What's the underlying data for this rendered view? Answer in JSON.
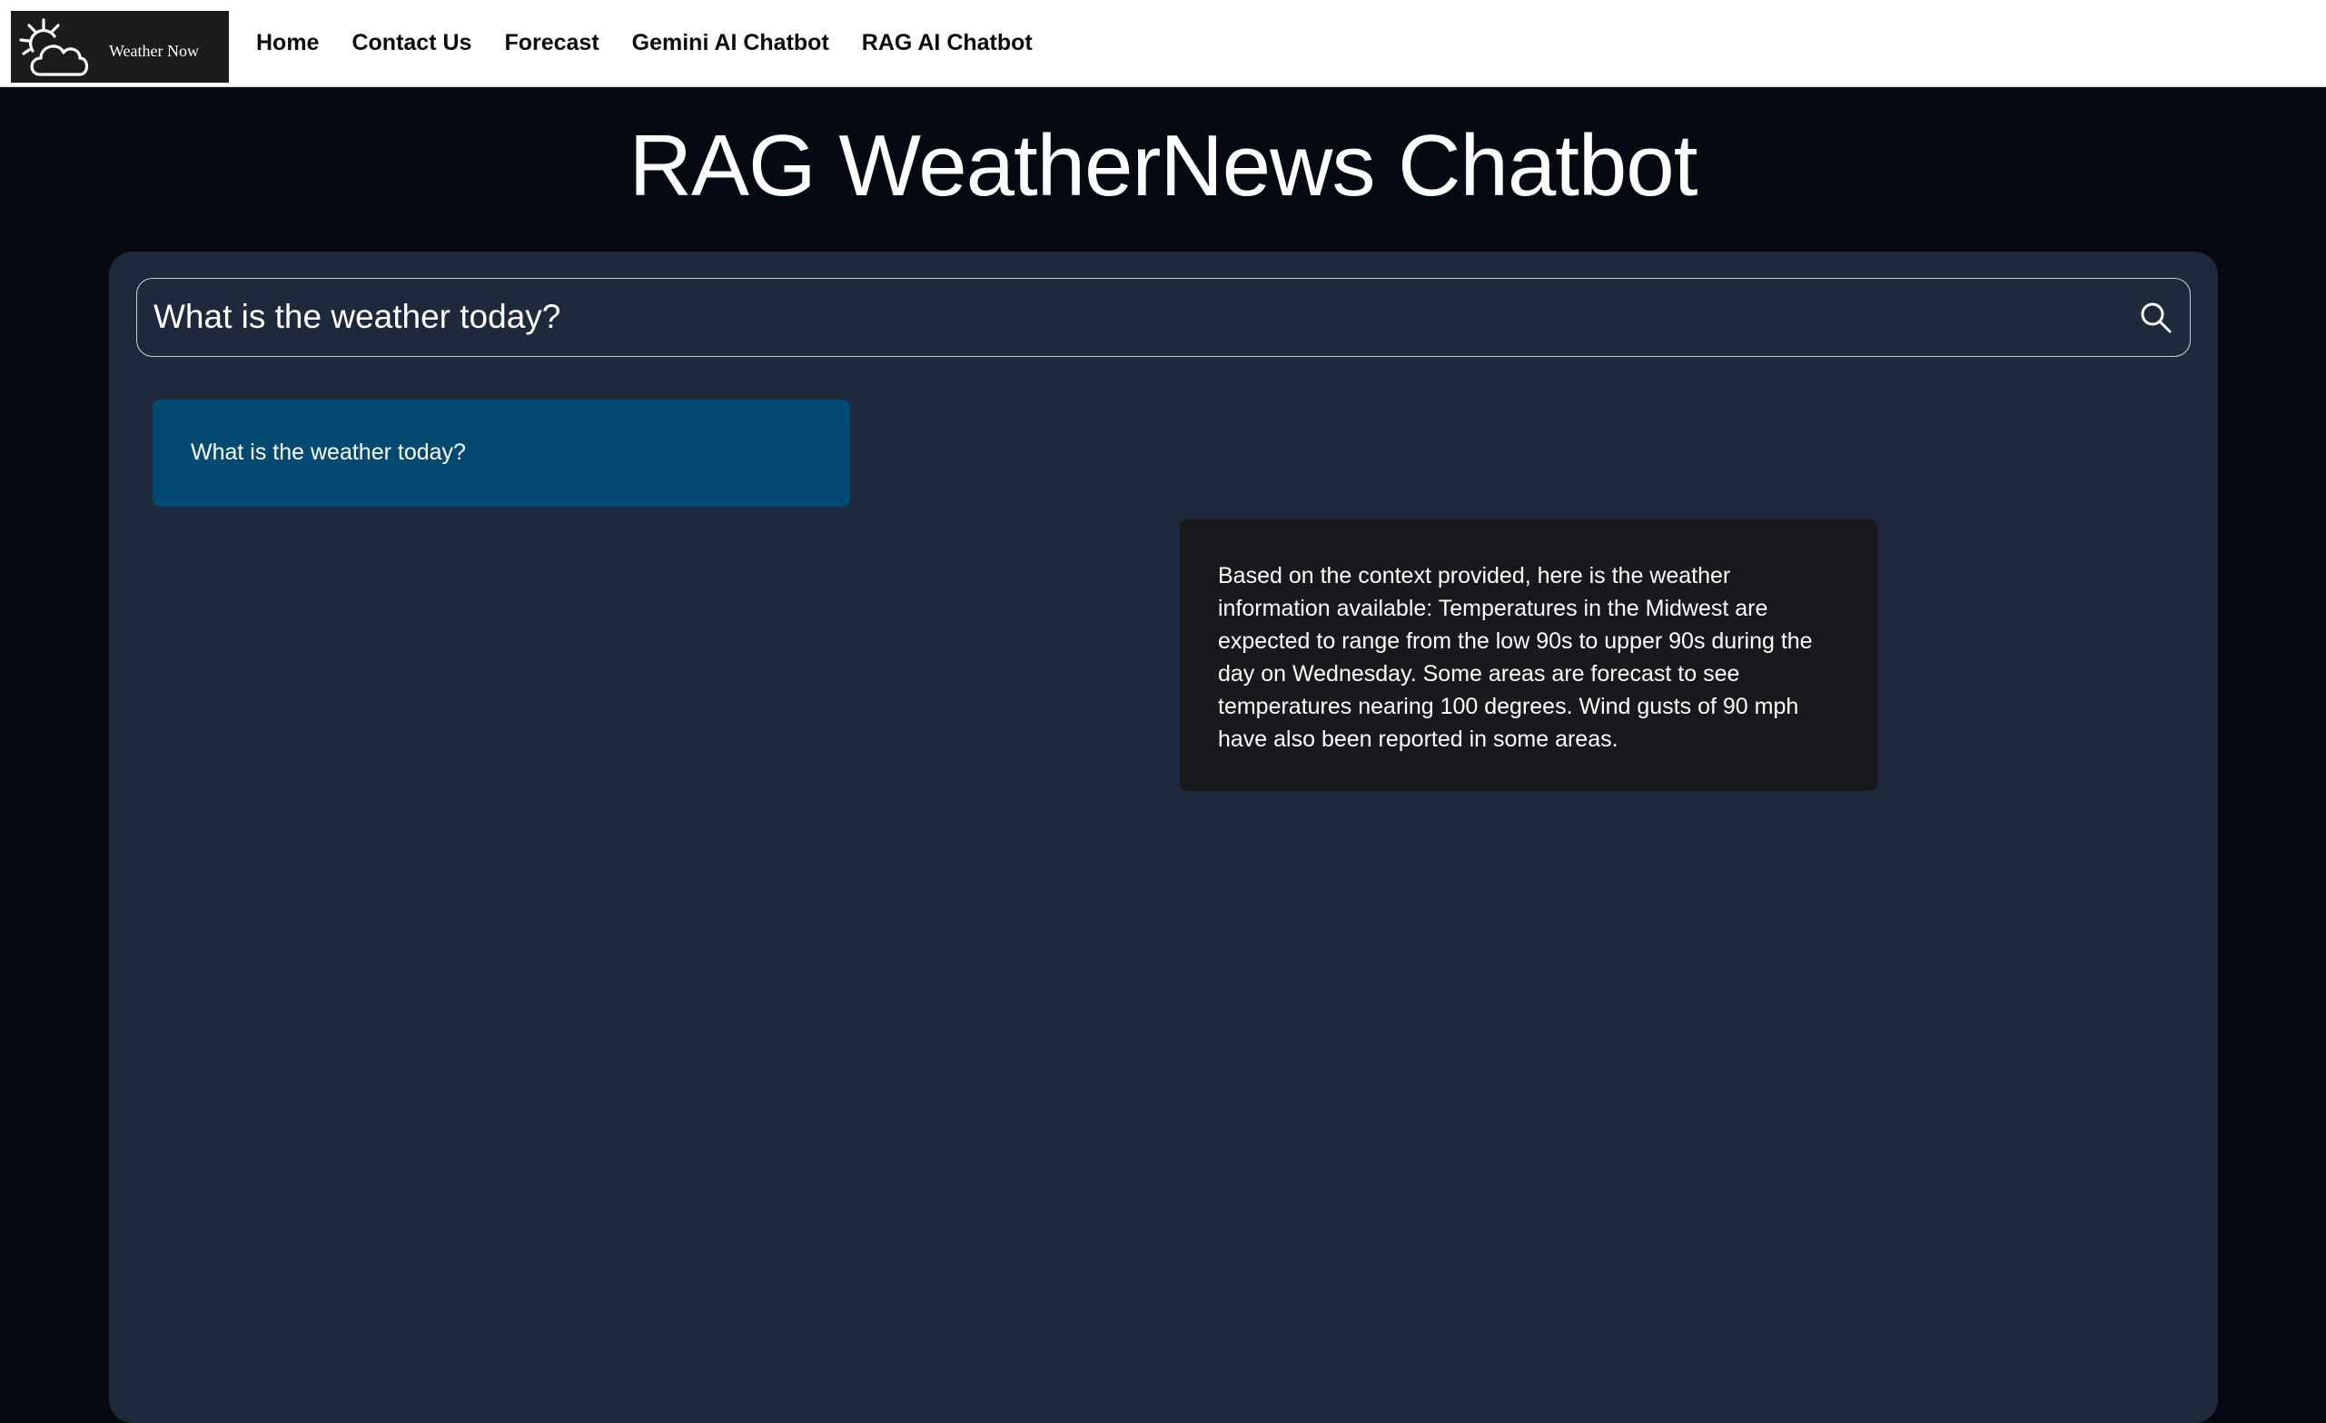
{
  "navbar": {
    "logo": {
      "icon": "sun-cloud-icon",
      "text": "Weather Now"
    },
    "links": [
      {
        "label": "Home"
      },
      {
        "label": "Contact Us"
      },
      {
        "label": "Forecast"
      },
      {
        "label": "Gemini AI Chatbot"
      },
      {
        "label": "RAG AI Chatbot"
      }
    ]
  },
  "page": {
    "title": "RAG WeatherNews Chatbot"
  },
  "search": {
    "value": "What is the weather today?",
    "icon": "search-icon"
  },
  "messages": {
    "user": {
      "text": "What is the weather today?"
    },
    "bot": {
      "text": "Based on the context provided, here is the weather information available: Temperatures in the Midwest are expected to range from the low 90s to upper 90s during the day on Wednesday. Some areas are forecast to see temperatures nearing 100 degrees. Wind gusts of 90 mph have also been reported in some areas."
    }
  },
  "colors": {
    "page_background": "#050912",
    "panel_background": "#1e2a3b",
    "user_bubble": "#034a73",
    "bot_bubble": "#18191c",
    "navbar_background": "#ffffff",
    "logo_background": "#1c1c1f"
  }
}
